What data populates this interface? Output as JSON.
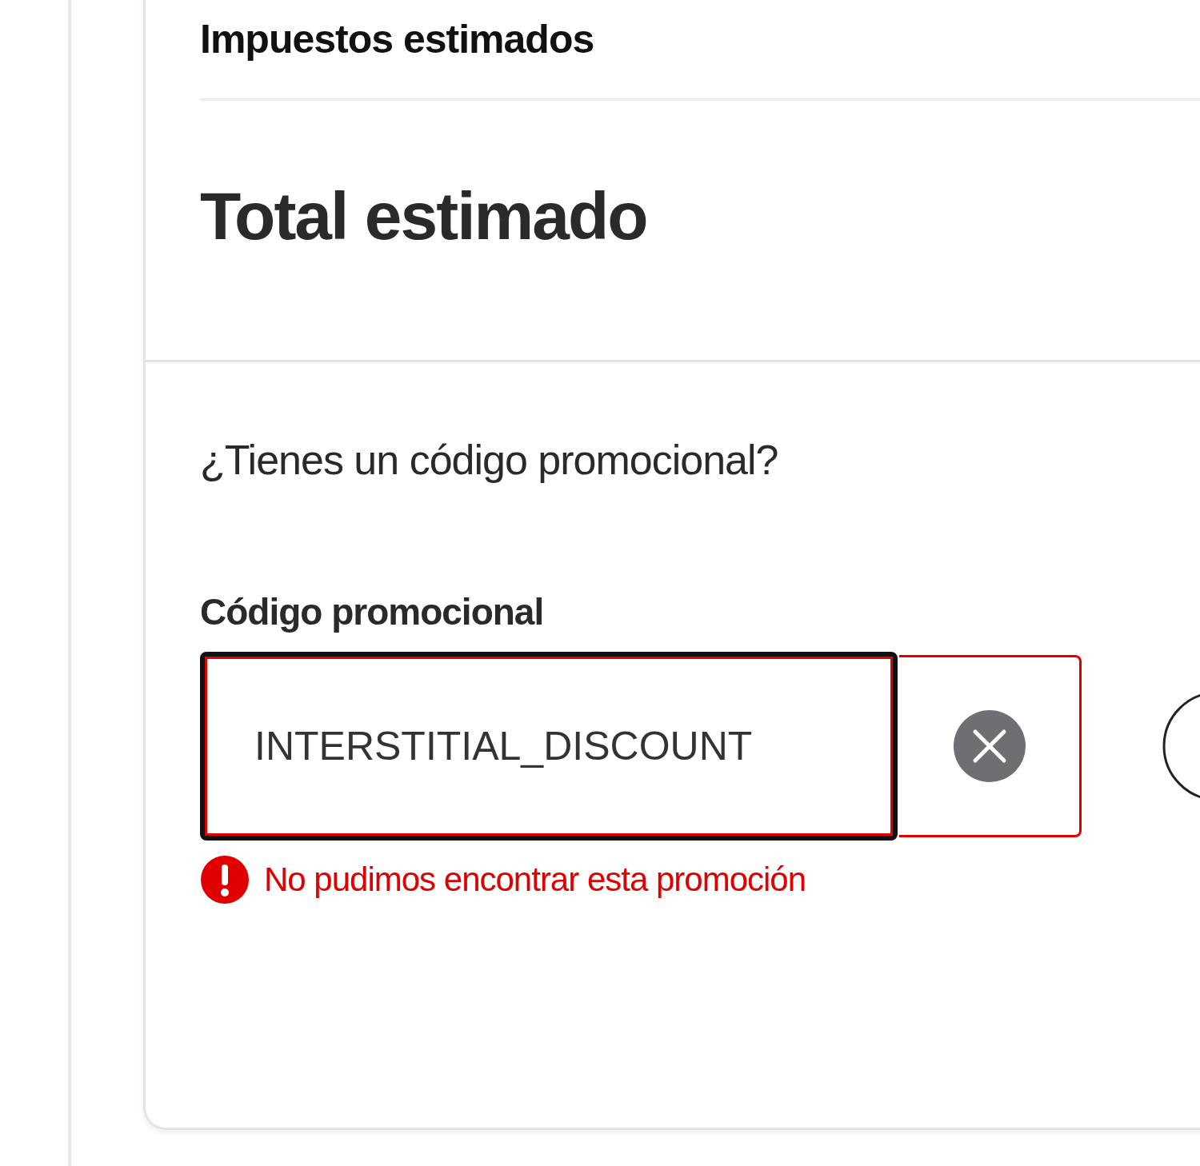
{
  "summary": {
    "taxes_label": "Impuestos estimados",
    "total_label": "Total estimado"
  },
  "promo": {
    "question": "¿Tienes un código promocional?",
    "field_label": "Código promocional",
    "value": "INTERSTITIAL_DISCOUNT",
    "error": true,
    "error_message": "No pudimos encontrar esta promoción"
  }
}
